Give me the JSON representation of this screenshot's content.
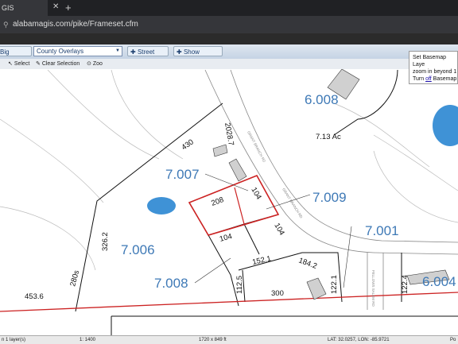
{
  "browser": {
    "tab_title": "GIS",
    "url": "alabamagis.com/pike/Frameset.cfm"
  },
  "toolbar": {
    "results_label": "Big Results",
    "overlay_select": "County Overlays",
    "street_view_label": "Street View",
    "show_legend_label": "Show Legend",
    "select_label": "Select",
    "clear_selection_label": "Clear Selection",
    "zoom_label": "Zoo"
  },
  "popup": {
    "line1": "Set Basemap Laye",
    "line2": "zoom in beyond 1",
    "line3_prefix": "Turn ",
    "line3_link": "off",
    "line3_suffix": " Basemap"
  },
  "map": {
    "parcels": [
      "6.008",
      "7.007",
      "7.009",
      "7.001",
      "7.006",
      "7.008",
      "6.004"
    ],
    "dimensions": [
      "430",
      "2028.7",
      "7.13 Ac",
      "208",
      "104",
      "104",
      "104",
      "326.2",
      "280s",
      "453.6",
      "152.1",
      "184.2",
      "112.5",
      "300",
      "122.1",
      "122.4"
    ],
    "road_labels": [
      "GRANT BRANCH RD",
      "GRANT BRANCH RD",
      "FELLOWS SALEM RD"
    ]
  },
  "status": {
    "layers": "n 1 layer(s)",
    "scale": "1: 1400",
    "extent": "1720 x 849 ft",
    "coords": "LAT: 32.0257, LON: -85.9721",
    "po": "Po"
  },
  "colors": {
    "parcel_label": "#3e79b6",
    "highlight": "#cc2222",
    "toolbar": "#dfe7f0"
  }
}
